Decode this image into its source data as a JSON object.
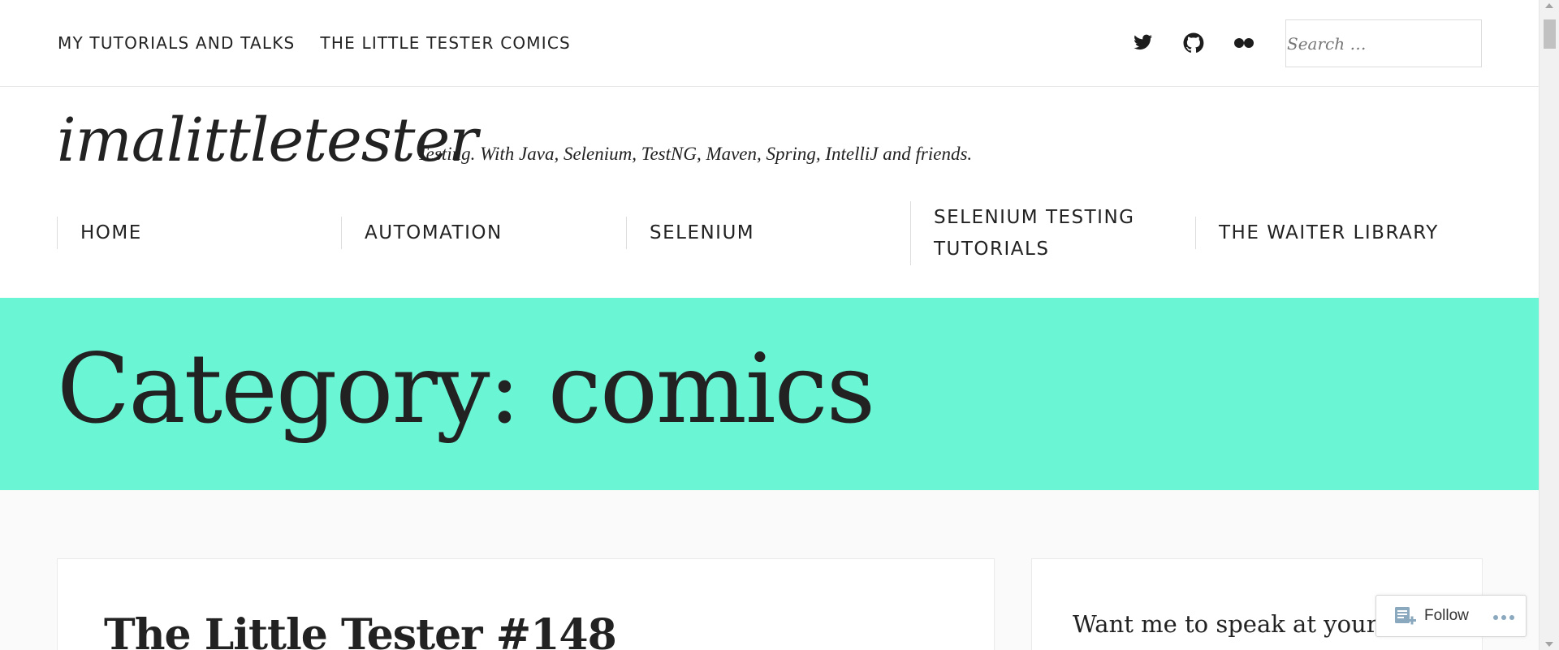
{
  "top_menu": {
    "items": [
      "MY TUTORIALS AND TALKS",
      "THE LITTLE TESTER COMICS"
    ]
  },
  "social": {
    "icons": [
      "twitter-icon",
      "github-icon",
      "flickr-icon"
    ]
  },
  "search": {
    "placeholder": "Search …"
  },
  "site": {
    "title": "imalittletester",
    "description": "Testing. With Java, Selenium, TestNG, Maven, Spring, IntelliJ and friends."
  },
  "main_nav": {
    "items": [
      "HOME",
      "AUTOMATION",
      "SELENIUM",
      "SELENIUM TESTING TUTORIALS",
      "THE WAITER LIBRARY"
    ]
  },
  "banner": {
    "heading": "Category: comics",
    "color": "#6af6d5"
  },
  "post": {
    "title": "The Little Tester #148"
  },
  "sidebar": {
    "text": "Want me to speak at your ev"
  },
  "follow": {
    "label": "Follow"
  }
}
